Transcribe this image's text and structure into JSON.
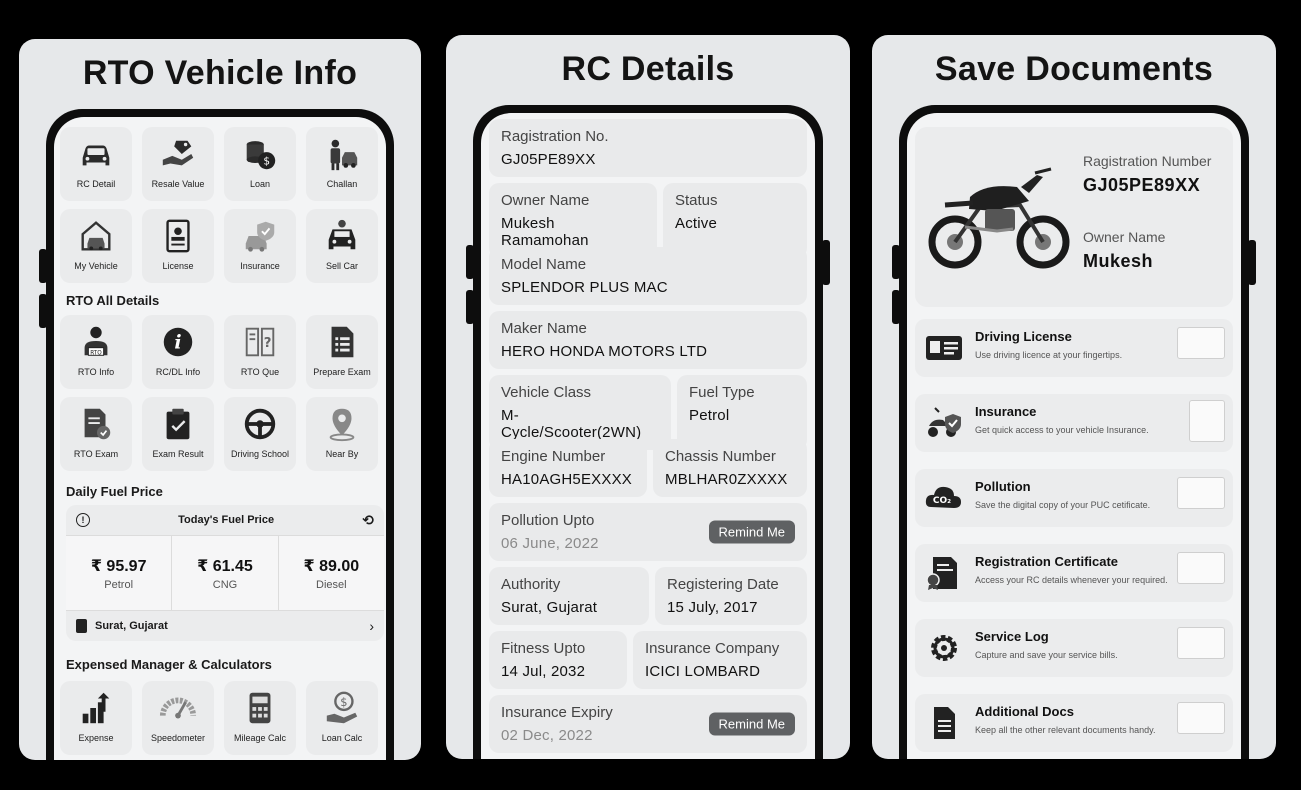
{
  "panel1": {
    "title": "RTO Vehicle Info",
    "row1": [
      "RC Detail",
      "Resale Value",
      "Loan",
      "Challan"
    ],
    "row2": [
      "My Vehicle",
      "License",
      "Insurance",
      "Sell Car"
    ],
    "section_rto": "RTO All Details",
    "row3": [
      "RTO Info",
      "RC/DL Info",
      "RTO Que",
      "Prepare Exam"
    ],
    "row4": [
      "RTO Exam",
      "Exam Result",
      "Driving School",
      "Near By"
    ],
    "section_fuel": "Daily Fuel Price",
    "fuel": {
      "header": "Today's Fuel Price",
      "items": [
        {
          "price": "₹ 95.97",
          "type": "Petrol"
        },
        {
          "price": "₹ 61.45",
          "type": "CNG"
        },
        {
          "price": "₹ 89.00",
          "type": "Diesel"
        }
      ],
      "location": "Surat, Gujarat"
    },
    "section_calc": "Expensed Manager & Calculators",
    "row5": [
      "Expense",
      "Speedometer",
      "Mileage Calc",
      "Loan Calc"
    ]
  },
  "panel2": {
    "title": "RC Details",
    "registration": {
      "label": "Ragistration No.",
      "value": "GJ05PE89XX"
    },
    "owner": {
      "label": "Owner Name",
      "value": "Mukesh Ramamohan"
    },
    "status": {
      "label": "Status",
      "value": "Active"
    },
    "model": {
      "label": "Model Name",
      "value": "SPLENDOR PLUS MAC"
    },
    "maker": {
      "label": "Maker Name",
      "value": "HERO HONDA MOTORS LTD"
    },
    "vclass": {
      "label": "Vehicle Class",
      "value": "M- Cycle/Scooter(2WN)"
    },
    "fuel": {
      "label": "Fuel Type",
      "value": "Petrol"
    },
    "engine": {
      "label": "Engine Number",
      "value": "HA10AGH5EXXXX"
    },
    "chassis": {
      "label": "Chassis Number",
      "value": "MBLHAR0ZXXXX"
    },
    "pollution": {
      "label": "Pollution Upto",
      "value": "06 June, 2022"
    },
    "authority": {
      "label": "Authority",
      "value": "Surat, Gujarat"
    },
    "regdate": {
      "label": "Registering Date",
      "value": "15 July, 2017"
    },
    "fitness": {
      "label": "Fitness Upto",
      "value": "14 Jul, 2032"
    },
    "insco": {
      "label": "Insurance Company",
      "value": "ICICI LOMBARD"
    },
    "insexp": {
      "label": "Insurance Expiry",
      "value": "02 Dec, 2022"
    },
    "remind_label": "Remind Me"
  },
  "panel3": {
    "title": "Save Documents",
    "reg_label": "Ragistration Number",
    "reg_value": "GJ05PE89XX",
    "owner_label": "Owner Name",
    "owner_value": "Mukesh",
    "docs": [
      {
        "title": "Driving License",
        "desc": "Use driving licence at your fingertips."
      },
      {
        "title": "Insurance",
        "desc": "Get quick access to your vehicle Insurance."
      },
      {
        "title": "Pollution",
        "desc": "Save the digital copy of your PUC cetificate."
      },
      {
        "title": "Registration Certificate",
        "desc": "Access your RC details whenever your required."
      },
      {
        "title": "Service Log",
        "desc": "Capture and save your service bills."
      },
      {
        "title": "Additional Docs",
        "desc": "Keep all the other relevant documents handy."
      }
    ]
  }
}
